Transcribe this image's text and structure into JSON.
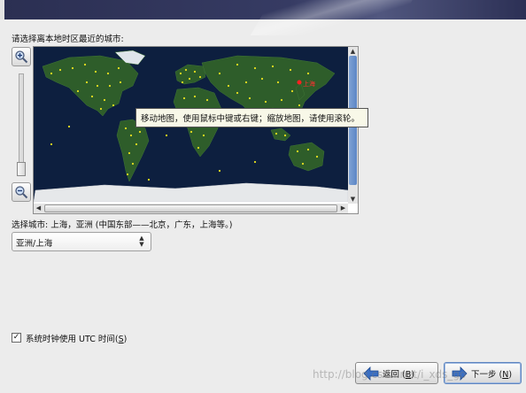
{
  "region_label": "请选择离本地时区最近的城市:",
  "tooltip": "移动地图，使用鼠标中键或右键；缩放地图，请使用滚轮。",
  "map_marker_label": "上海",
  "selected_city_label": "选择城市: 上海，亚洲 (中国东部——北京，广东，上海等。)",
  "city_select": {
    "value": "亚洲/上海"
  },
  "utc": {
    "checked": true,
    "label": "系统时钟使用 UTC 时间(",
    "mnemonic": "S",
    "suffix": ")"
  },
  "buttons": {
    "back": {
      "label": "返回 (",
      "mnemonic": "B",
      "suffix": ")"
    },
    "next": {
      "label": "下一步 (",
      "mnemonic": "N",
      "suffix": ")"
    }
  },
  "watermark": "http://blog.csdn.net/i_xds_go",
  "colors": {
    "map_ocean": "#0d1f3f",
    "land": "#2e5d2a",
    "city_dot": "#e8e020",
    "selected_city": "#ff2020"
  }
}
